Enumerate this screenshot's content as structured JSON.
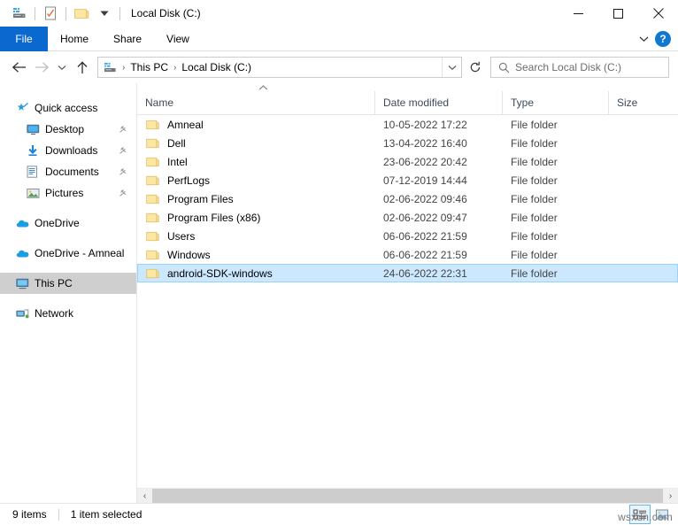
{
  "window": {
    "title": "Local Disk (C:)",
    "quick_access_icons": [
      "this-pc-icon",
      "properties-icon",
      "new-folder-icon",
      "customize-dropdown-icon"
    ],
    "controls": {
      "minimize": "minimize-icon",
      "maximize": "maximize-icon",
      "close": "close-icon"
    }
  },
  "ribbon": {
    "tabs": [
      {
        "label": "File",
        "active": true
      },
      {
        "label": "Home",
        "active": false
      },
      {
        "label": "Share",
        "active": false
      },
      {
        "label": "View",
        "active": false
      }
    ],
    "collapse_icon": "chevron-down-icon",
    "help_label": "?"
  },
  "address": {
    "back_icon": "arrow-left-icon",
    "forward_icon": "arrow-right-icon",
    "recent_icon": "chevron-down-icon",
    "up_icon": "arrow-up-icon",
    "crumb_icon": "this-pc-icon",
    "breadcrumbs": [
      "This PC",
      "Local Disk (C:)"
    ],
    "separator": "›",
    "dropdown_icon": "chevron-down-icon",
    "refresh_icon": "refresh-icon"
  },
  "search": {
    "icon": "search-icon",
    "placeholder": "Search Local Disk (C:)",
    "value": ""
  },
  "sidebar": {
    "items": [
      {
        "label": "Quick access",
        "icon": "star-pin-icon",
        "indent": false,
        "pinned": false,
        "selected": false
      },
      {
        "label": "Desktop",
        "icon": "desktop-icon",
        "indent": true,
        "pinned": true,
        "selected": false
      },
      {
        "label": "Downloads",
        "icon": "downloads-icon",
        "indent": true,
        "pinned": true,
        "selected": false
      },
      {
        "label": "Documents",
        "icon": "documents-icon",
        "indent": true,
        "pinned": true,
        "selected": false
      },
      {
        "label": "Pictures",
        "icon": "pictures-icon",
        "indent": true,
        "pinned": true,
        "selected": false
      },
      {
        "label": "OneDrive",
        "icon": "onedrive-icon",
        "indent": false,
        "pinned": false,
        "selected": false
      },
      {
        "label": "OneDrive - Amneal",
        "icon": "onedrive-icon",
        "indent": false,
        "pinned": false,
        "selected": false
      },
      {
        "label": "This PC",
        "icon": "this-pc-icon",
        "indent": false,
        "pinned": false,
        "selected": true
      },
      {
        "label": "Network",
        "icon": "network-icon",
        "indent": false,
        "pinned": false,
        "selected": false
      }
    ]
  },
  "filelist": {
    "sort_indicator": "sort-ascending-caret",
    "columns": [
      {
        "key": "name",
        "label": "Name"
      },
      {
        "key": "date",
        "label": "Date modified"
      },
      {
        "key": "type",
        "label": "Type"
      },
      {
        "key": "size",
        "label": "Size"
      }
    ],
    "rows": [
      {
        "name": "Amneal",
        "date": "10-05-2022 17:22",
        "type": "File folder",
        "size": "",
        "selected": false
      },
      {
        "name": "Dell",
        "date": "13-04-2022 16:40",
        "type": "File folder",
        "size": "",
        "selected": false
      },
      {
        "name": "Intel",
        "date": "23-06-2022 20:42",
        "type": "File folder",
        "size": "",
        "selected": false
      },
      {
        "name": "PerfLogs",
        "date": "07-12-2019 14:44",
        "type": "File folder",
        "size": "",
        "selected": false
      },
      {
        "name": "Program Files",
        "date": "02-06-2022 09:46",
        "type": "File folder",
        "size": "",
        "selected": false
      },
      {
        "name": "Program Files (x86)",
        "date": "02-06-2022 09:47",
        "type": "File folder",
        "size": "",
        "selected": false
      },
      {
        "name": "Users",
        "date": "06-06-2022 21:59",
        "type": "File folder",
        "size": "",
        "selected": false
      },
      {
        "name": "Windows",
        "date": "06-06-2022 21:59",
        "type": "File folder",
        "size": "",
        "selected": false
      },
      {
        "name": "android-SDK-windows",
        "date": "24-06-2022 22:31",
        "type": "File folder",
        "size": "",
        "selected": true
      }
    ]
  },
  "scrollbar": {
    "left_arrow": "‹",
    "right_arrow": "›"
  },
  "statusbar": {
    "item_count": "9 items",
    "selection": "1 item selected",
    "view_details_icon": "details-view-icon",
    "view_large_icon": "large-icons-view-icon"
  },
  "watermark": {
    "text": "wsxdn.com"
  },
  "colors": {
    "accent": "#0b68ce",
    "selection_fill": "#cce8ff",
    "selection_border": "#99d1ff",
    "sidebar_selected": "#cfcfcf",
    "folder_yellow": "#fbe6a2",
    "help_blue": "#1277cf"
  }
}
